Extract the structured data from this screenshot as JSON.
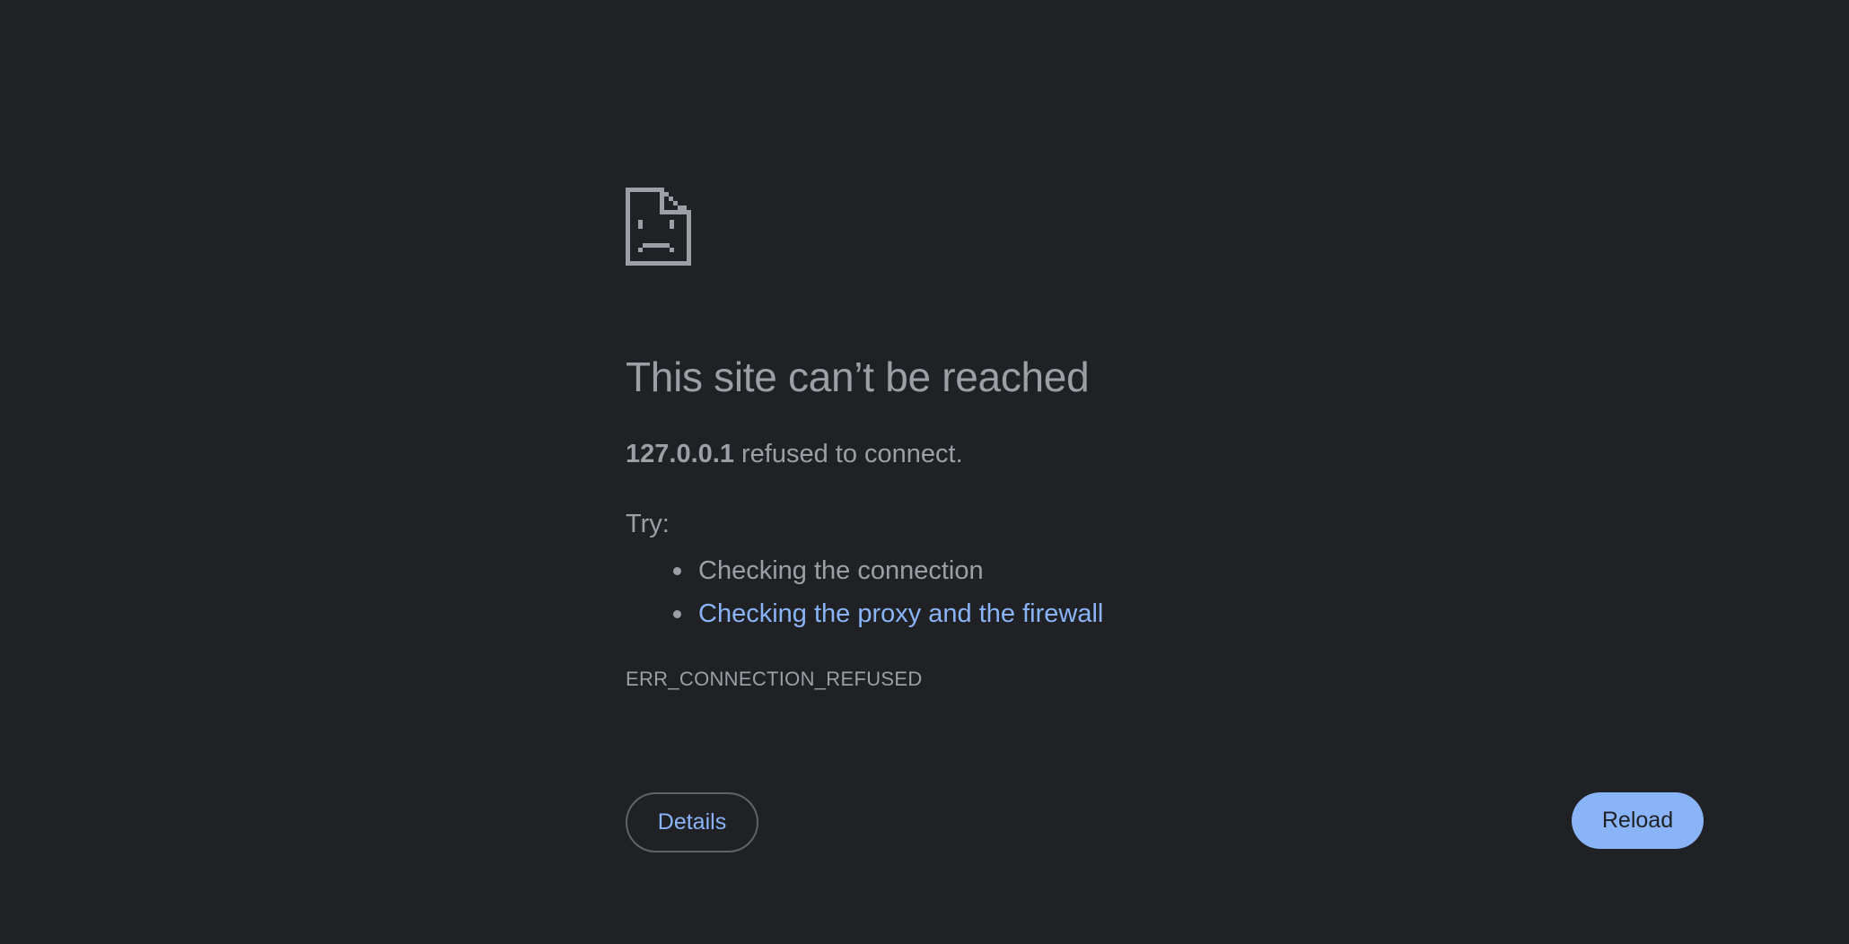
{
  "page": {
    "icon": "sad-document-icon",
    "title": "This site can’t be reached",
    "summary": {
      "host": "127.0.0.1",
      "message": " refused to connect."
    },
    "try_label": "Try:",
    "suggestions": [
      {
        "text": "Checking the connection",
        "is_link": false
      },
      {
        "text": "Checking the proxy and the firewall",
        "is_link": true
      }
    ],
    "error_code": "ERR_CONNECTION_REFUSED"
  },
  "buttons": {
    "details_label": "Details",
    "reload_label": "Reload"
  },
  "colors": {
    "background": "#202124",
    "text": "#9aa0a6",
    "link": "#8ab4f8",
    "primary_button": "#8ab4f8",
    "outline": "#5f6368"
  }
}
